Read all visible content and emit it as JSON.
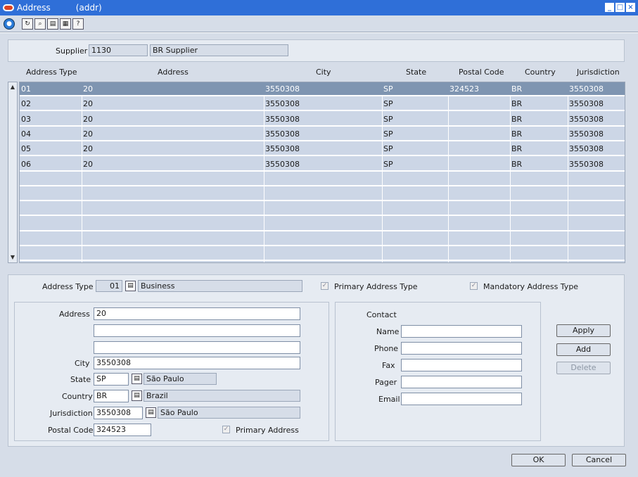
{
  "window": {
    "title": "Address",
    "subtitle": "(addr)"
  },
  "header": {
    "supplier_label": "Supplier",
    "supplier_id": "1130",
    "supplier_name": "BR Supplier"
  },
  "table": {
    "columns": [
      "Address Type",
      "Address",
      "City",
      "State",
      "Postal Code",
      "Country",
      "Jurisdiction"
    ],
    "rows": [
      [
        "01",
        "20",
        "3550308",
        "SP",
        "324523",
        "BR",
        "3550308"
      ],
      [
        "02",
        "20",
        "3550308",
        "SP",
        "",
        "BR",
        "3550308"
      ],
      [
        "03",
        "20",
        "3550308",
        "SP",
        "",
        "BR",
        "3550308"
      ],
      [
        "04",
        "20",
        "3550308",
        "SP",
        "",
        "BR",
        "3550308"
      ],
      [
        "05",
        "20",
        "3550308",
        "SP",
        "",
        "BR",
        "3550308"
      ],
      [
        "06",
        "20",
        "3550308",
        "SP",
        "",
        "BR",
        "3550308"
      ]
    ]
  },
  "detail": {
    "address_type_label": "Address Type",
    "address_type_code": "01",
    "address_type_desc": "Business",
    "primary_address_type_label": "Primary Address Type",
    "mandatory_address_type_label": "Mandatory Address Type",
    "address_label": "Address",
    "address_line1": "20",
    "address_line2": "",
    "address_line3": "",
    "city_label": "City",
    "city": "3550308",
    "state_label": "State",
    "state": "SP",
    "state_desc": "São Paulo",
    "country_label": "Country",
    "country": "BR",
    "country_desc": "Brazil",
    "jurisdiction_label": "Jurisdiction",
    "jurisdiction": "3550308",
    "jurisdiction_desc": "São Paulo",
    "postal_code_label": "Postal Code",
    "postal_code": "324523",
    "primary_address_label": "Primary Address"
  },
  "contact": {
    "title": "Contact",
    "name_label": "Name",
    "phone_label": "Phone",
    "fax_label": "Fax",
    "pager_label": "Pager",
    "email_label": "Email",
    "name": "",
    "phone": "",
    "fax": "",
    "pager": "",
    "email": ""
  },
  "buttons": {
    "apply": "Apply",
    "add": "Add",
    "delete": "Delete",
    "ok": "OK",
    "cancel": "Cancel"
  }
}
